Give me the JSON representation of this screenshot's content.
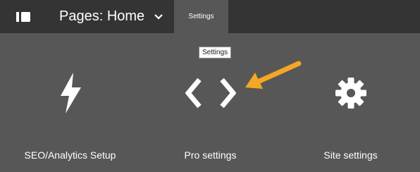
{
  "header": {
    "page_title": "Pages: Home",
    "active_tab": "Settings"
  },
  "tooltip": {
    "text": "Settings"
  },
  "tiles": [
    {
      "label": "SEO/Analytics Setup",
      "icon": "lightning-bolt-icon"
    },
    {
      "label": "Pro settings",
      "icon": "code-brackets-icon"
    },
    {
      "label": "Site settings",
      "icon": "gear-icon"
    }
  ],
  "colors": {
    "topbar": "#343434",
    "panel": "#575757",
    "annotation_arrow": "#f5a623"
  }
}
